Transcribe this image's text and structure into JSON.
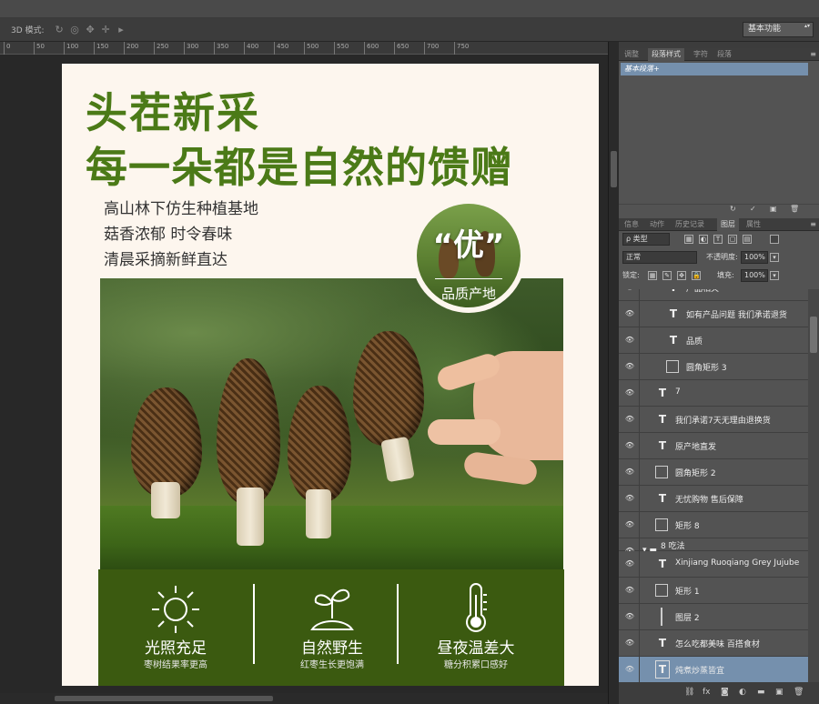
{
  "options_bar": {
    "mode_label": "3D 模式:",
    "icons": [
      "orbit-icon",
      "roll-icon",
      "pan-icon",
      "slide-icon",
      "camera-icon"
    ],
    "workspace": "基本功能"
  },
  "ruler": {
    "labels": [
      "0",
      "50",
      "100",
      "150",
      "200",
      "250",
      "300",
      "350",
      "400",
      "450",
      "500",
      "550",
      "600",
      "650",
      "700",
      "750"
    ]
  },
  "document": {
    "headline_1": "头茬新采",
    "headline_2": "每一朵都是自然的馈赠",
    "subtitles": [
      "高山林下仿生种植基地",
      "菇香浓郁 时令春味",
      "清晨采摘新鲜直达"
    ],
    "badge_char": "优",
    "badge_quote_left": "“",
    "badge_quote_right": "”",
    "badge_caption": "品质产地",
    "features": [
      {
        "icon": "sun-icon",
        "title": "光照充足",
        "subtitle": "枣树结果率更高"
      },
      {
        "icon": "sprout-icon",
        "title": "自然野生",
        "subtitle": "红枣生长更饱满"
      },
      {
        "icon": "thermometer-icon",
        "title": "昼夜温差大",
        "subtitle": "糖分积累口感好"
      }
    ]
  },
  "panel_top": {
    "tabs": [
      "调整",
      "段落样式",
      "字符",
      "段落"
    ],
    "active_tab": "段落样式",
    "selected_style": "基本段落+"
  },
  "panel_layers": {
    "tabs": [
      "信息",
      "动作",
      "历史记录",
      "图层",
      "属性"
    ],
    "active_tab": "图层",
    "filter_kind": "ρ 类型",
    "blend_mode": "正常",
    "opacity_label": "不透明度:",
    "opacity_value": "100%",
    "lock_label": "锁定:",
    "fill_label": "填充:",
    "fill_value": "100%",
    "layers": [
      {
        "type": "text",
        "name": "产品相关",
        "indent": 2,
        "selected": false
      },
      {
        "type": "text",
        "name": "如有产品问题 我们承诺退货",
        "indent": 2,
        "selected": false
      },
      {
        "type": "text",
        "name": "品质",
        "indent": 2,
        "selected": false
      },
      {
        "type": "shape",
        "name": "圆角矩形 3",
        "indent": 2,
        "selected": false
      },
      {
        "type": "text",
        "name": "7",
        "indent": 1,
        "selected": false
      },
      {
        "type": "text",
        "name": "我们承诺7天无理由退换货",
        "indent": 1,
        "selected": false
      },
      {
        "type": "text",
        "name": "原产地直发",
        "indent": 1,
        "selected": false
      },
      {
        "type": "shape",
        "name": "圆角矩形 2",
        "indent": 1,
        "selected": false
      },
      {
        "type": "text",
        "name": "无忧购物  售后保障",
        "indent": 1,
        "selected": false
      },
      {
        "type": "shape",
        "name": "矩形 8",
        "indent": 1,
        "selected": false
      },
      {
        "type": "group",
        "name": "8 吃法",
        "indent": 0,
        "selected": false
      },
      {
        "type": "text",
        "name": "Xinjiang Ruoqiang Grey Jujube",
        "indent": 1,
        "selected": false
      },
      {
        "type": "shape",
        "name": "矩形 1",
        "indent": 1,
        "selected": false
      },
      {
        "type": "pixel",
        "name": "图层 2",
        "indent": 1,
        "selected": false
      },
      {
        "type": "text",
        "name": "怎么吃都美味 百搭食材",
        "indent": 1,
        "selected": false
      },
      {
        "type": "text",
        "name": "炖煮炒蒸皆宜",
        "indent": 1,
        "selected": true
      }
    ]
  },
  "colors": {
    "headline_green": "#4b7a17",
    "band_green": "#3b5a10",
    "selection_blue": "#7590ad",
    "panel_gray": "#535353"
  }
}
